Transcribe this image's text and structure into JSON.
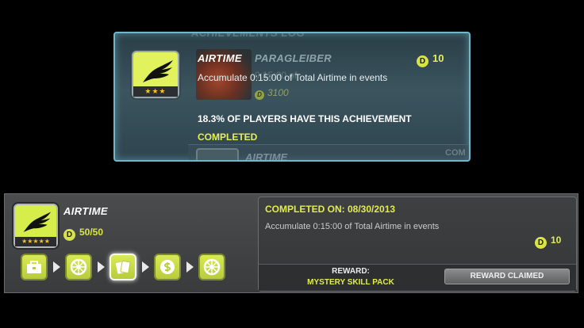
{
  "tooltip": {
    "background_header": "ACHIEVEMENTS LOG",
    "background_card": {
      "name": "PARAGLEIBER",
      "ghost_text": "0:15:00 of",
      "price": "3100",
      "coin_glyph": "D"
    },
    "background_next": {
      "name": "AIRTIME",
      "status_short": "COM"
    },
    "achievement": {
      "name": "AIRTIME",
      "points": "10",
      "coin_glyph": "D",
      "stars": "★★★",
      "description": "Accumulate 0:15:00 of Total Airtime in events",
      "players_percent_text": "18.3% OF PLAYERS HAVE THIS ACHIEVEMENT",
      "status": "COMPLETED"
    }
  },
  "panel": {
    "name": "AIRTIME",
    "coin_glyph": "D",
    "stars": "★★★★★",
    "progress": "50/50",
    "tiers": [
      {
        "icon": "toolbox-icon",
        "active": false
      },
      {
        "icon": "wheel-icon",
        "active": false
      },
      {
        "icon": "cards-icon",
        "active": true
      },
      {
        "icon": "cash-icon",
        "active": false
      },
      {
        "icon": "wheel-icon",
        "active": false
      }
    ],
    "detail": {
      "completed_on": "COMPLETED ON: 08/30/2013",
      "description": "Accumulate 0:15:00 of Total Airtime in events",
      "points": "10",
      "reward_label": "REWARD:",
      "reward_value": "MYSTERY SKILL PACK",
      "claim_button": "REWARD CLAIMED"
    }
  },
  "colors": {
    "accent_yellow": "#e1ec4e",
    "icon_green": "#d6ee4c",
    "tooltip_border": "#6fb7c9",
    "star_gold": "#f5c51c"
  }
}
